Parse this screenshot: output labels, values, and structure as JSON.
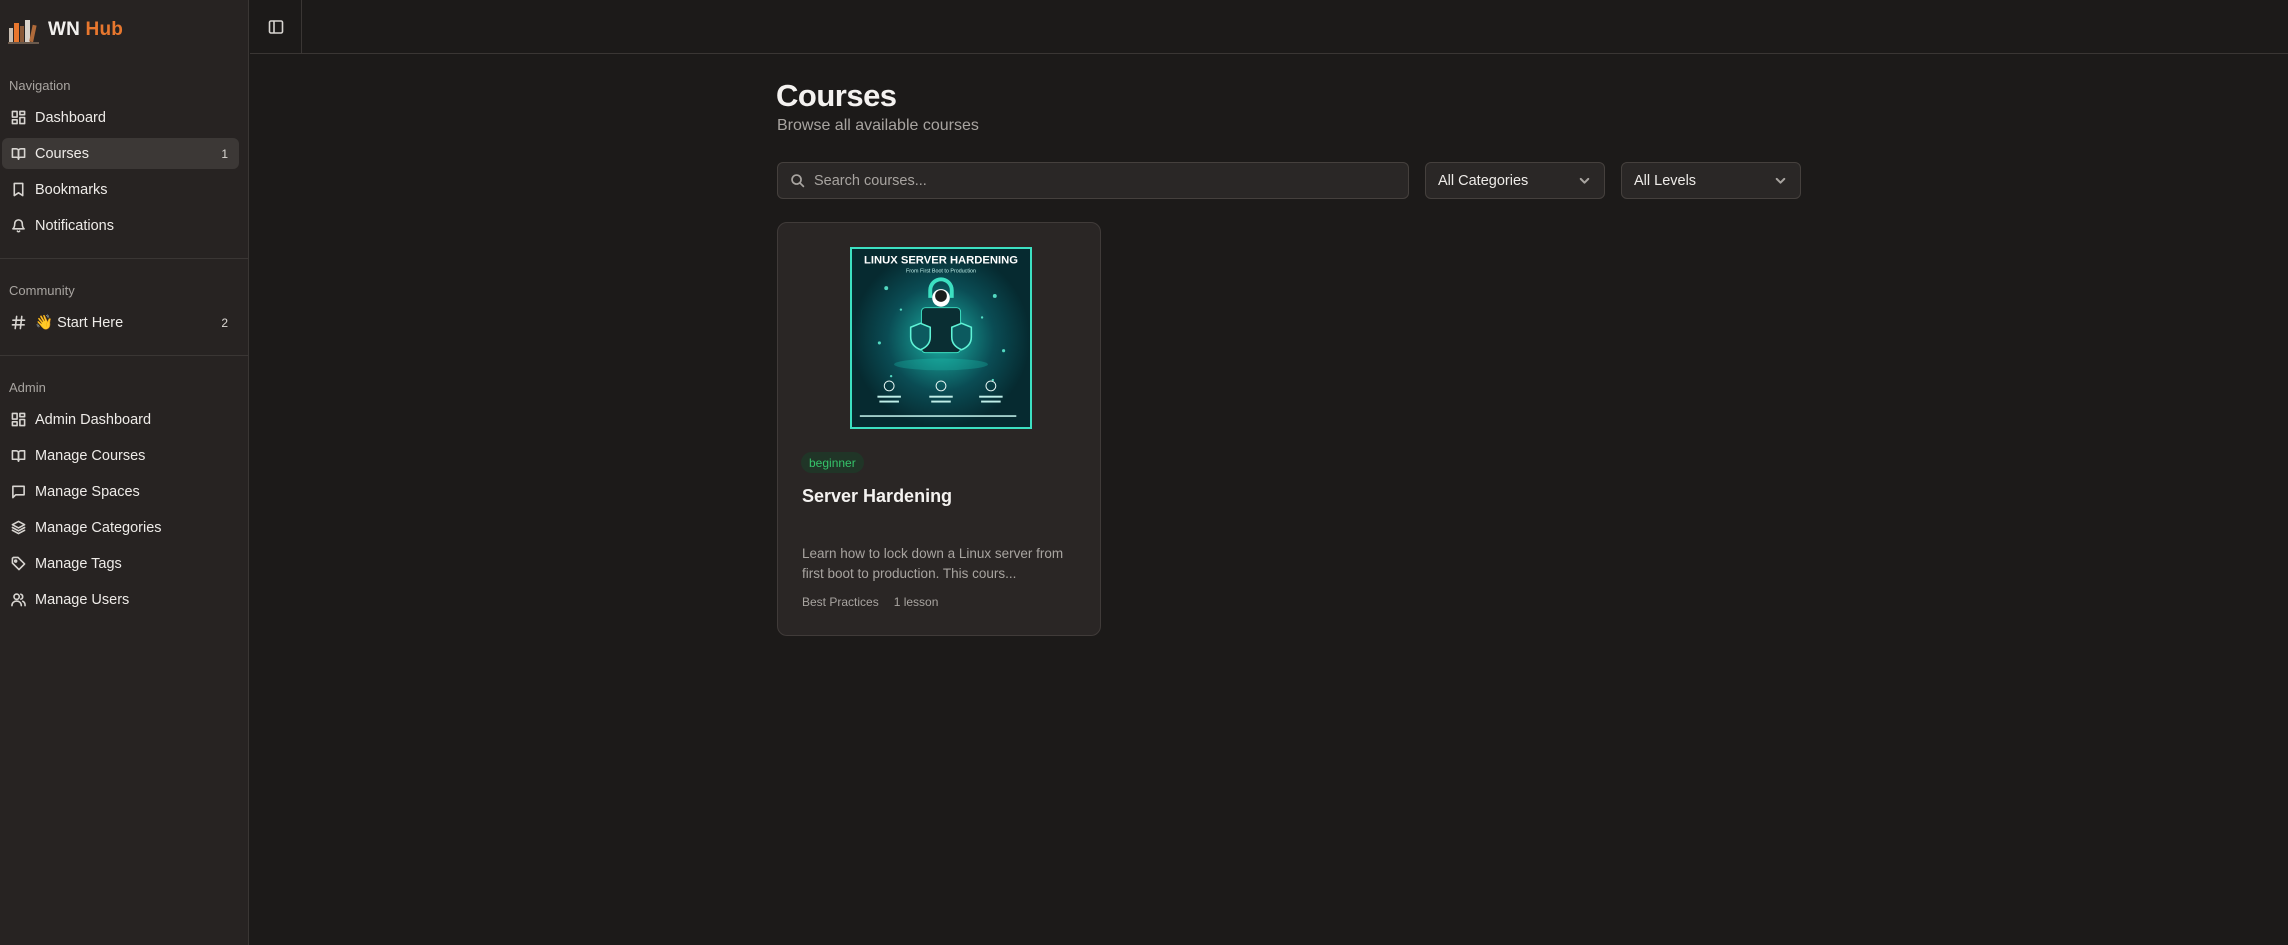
{
  "brand": {
    "name_main": "WN",
    "name_accent": "Hub"
  },
  "sidebar": {
    "sections": [
      {
        "label": "Navigation"
      },
      {
        "label": "Community"
      },
      {
        "label": "Admin"
      }
    ],
    "navigation": [
      {
        "label": "Dashboard",
        "icon": "dashboard-grid-icon"
      },
      {
        "label": "Courses",
        "icon": "book-open-icon",
        "badge": "1",
        "active": true
      },
      {
        "label": "Bookmarks",
        "icon": "bookmark-icon"
      },
      {
        "label": "Notifications",
        "icon": "bell-icon"
      }
    ],
    "community": [
      {
        "label": "👋 Start Here",
        "icon": "hash-icon",
        "badge": "2"
      }
    ],
    "admin": [
      {
        "label": "Admin Dashboard",
        "icon": "dashboard-grid-icon"
      },
      {
        "label": "Manage Courses",
        "icon": "book-open-icon"
      },
      {
        "label": "Manage Spaces",
        "icon": "message-square-icon"
      },
      {
        "label": "Manage Categories",
        "icon": "layers-icon"
      },
      {
        "label": "Manage Tags",
        "icon": "tag-icon"
      },
      {
        "label": "Manage Users",
        "icon": "users-icon"
      }
    ]
  },
  "main": {
    "title": "Courses",
    "subtitle": "Browse all available courses",
    "search": {
      "placeholder": "Search courses...",
      "value": ""
    },
    "filters": {
      "category": {
        "selected": "All Categories"
      },
      "level": {
        "selected": "All Levels"
      }
    },
    "courses": [
      {
        "thumbnail": {
          "title": "LINUX SERVER HARDENING",
          "subtitle": "From First Boot to Production"
        },
        "level": "beginner",
        "title": "Server Hardening",
        "description": "Learn how to lock down a Linux server from first boot to production. This cours...",
        "category": "Best Practices",
        "lessons": "1 lesson"
      }
    ]
  },
  "colors": {
    "accent": "#e8772e",
    "background": "#1c1a19",
    "sidebar": "#272322",
    "badge_green": "#35c46a",
    "thumbnail_teal": "#3ce0c2"
  }
}
